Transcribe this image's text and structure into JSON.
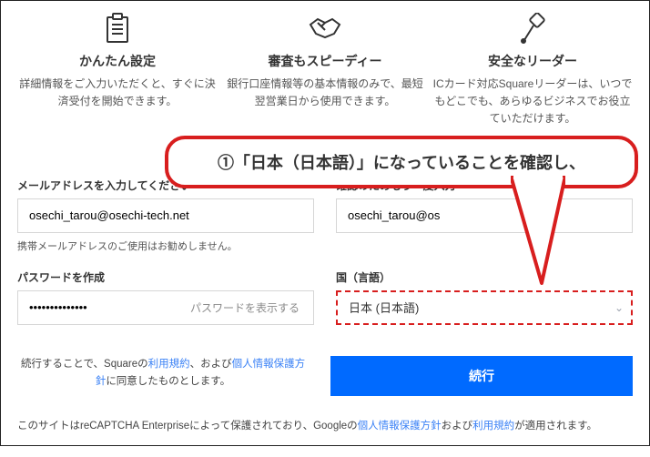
{
  "features": [
    {
      "title": "かんたん設定",
      "desc": "詳細情報をご入力いただくと、すぐに決済受付を開始できます。"
    },
    {
      "title": "審査もスピーディー",
      "desc": "銀行口座情報等の基本情報のみで、最短翌営業日から使用できます。"
    },
    {
      "title": "安全なリーダー",
      "desc": "ICカード対応Squareリーダーは、いつでもどこでも、あらゆるビジネスでお役立ていただけます。"
    }
  ],
  "callout": "①「日本（日本語）」になっていることを確認し、",
  "email": {
    "label": "メールアドレスを入力してください",
    "value": "osechi_tarou@osechi-tech.net",
    "hint": "携帯メールアドレスのご使用はお勧めしません。"
  },
  "emailConfirm": {
    "label": "確認のためもう一度入力",
    "value": "osechi_tarou@os"
  },
  "password": {
    "label": "パスワードを作成",
    "masked": "••••••••••••••",
    "toggle": "パスワードを表示する"
  },
  "country": {
    "label": "国（言語）",
    "selected": "日本 (日本語)"
  },
  "agree": {
    "pre": "続行することで、Squareの",
    "link1": "利用規約",
    "mid": "、および",
    "link2": "個人情報保護方針",
    "post": "に同意したものとします。"
  },
  "continue": "続行",
  "footer": {
    "pre": "このサイトはreCAPTCHA Enterpriseによって保護されており、Googleの",
    "link1": "個人情報保護方針",
    "mid": "および",
    "link2": "利用規約",
    "post": "が適用されます。"
  }
}
